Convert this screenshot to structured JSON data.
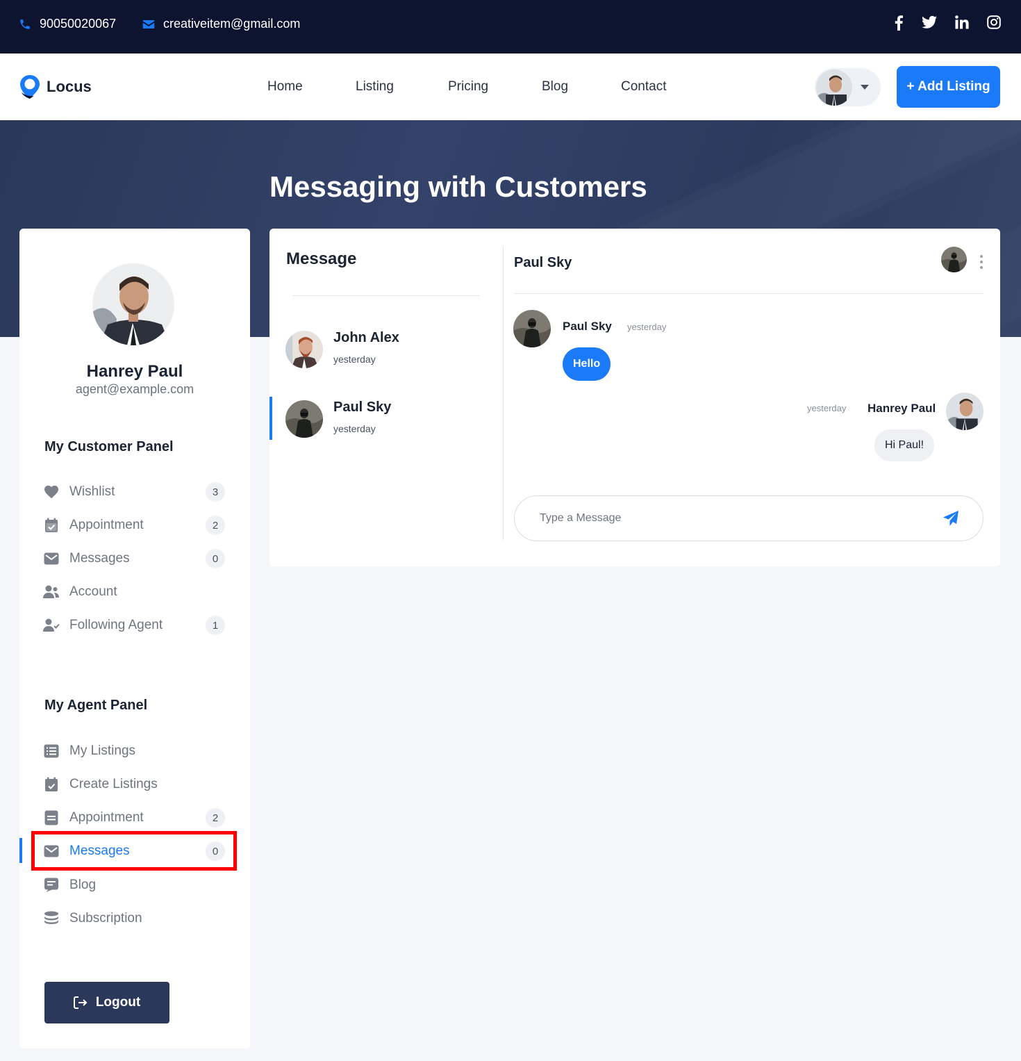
{
  "topbar": {
    "phone": "90050020067",
    "email": "creativeitem@gmail.com",
    "social": [
      "facebook-icon",
      "twitter-icon",
      "linkedin-icon",
      "instagram-icon"
    ]
  },
  "nav": {
    "logo": "Locus",
    "links": [
      "Home",
      "Listing",
      "Pricing",
      "Blog",
      "Contact"
    ],
    "add_listing": "+ Add Listing"
  },
  "hero": {
    "title": "Messaging with Customers"
  },
  "profile": {
    "name": "Hanrey Paul",
    "email": "agent@example.com"
  },
  "customer_panel": {
    "title": "My Customer Panel",
    "items": [
      {
        "label": "Wishlist",
        "icon": "heart-icon",
        "badge": "3"
      },
      {
        "label": "Appointment",
        "icon": "calendar-check-icon",
        "badge": "2"
      },
      {
        "label": "Messages",
        "icon": "envelope-icon",
        "badge": "0"
      },
      {
        "label": "Account",
        "icon": "users-icon",
        "badge": ""
      },
      {
        "label": "Following Agent",
        "icon": "user-check-icon",
        "badge": "1"
      }
    ]
  },
  "agent_panel": {
    "title": "My Agent Panel",
    "items": [
      {
        "label": "My Listings",
        "icon": "list-icon",
        "badge": ""
      },
      {
        "label": "Create Listings",
        "icon": "calendar-check-icon",
        "badge": ""
      },
      {
        "label": "Appointment",
        "icon": "note-icon",
        "badge": "2"
      },
      {
        "label": "Messages",
        "icon": "envelope-icon",
        "badge": "0"
      },
      {
        "label": "Blog",
        "icon": "blog-icon",
        "badge": ""
      },
      {
        "label": "Subscription",
        "icon": "coins-icon",
        "badge": ""
      }
    ]
  },
  "logout": "Logout",
  "messages": {
    "heading": "Message",
    "contacts": [
      {
        "name": "John Alex",
        "time": "yesterday"
      },
      {
        "name": "Paul Sky",
        "time": "yesterday"
      }
    ]
  },
  "chat": {
    "header_name": "Paul Sky",
    "thread": [
      {
        "sender": "Paul Sky",
        "time": "yesterday",
        "text": "Hello"
      },
      {
        "sender": "Hanrey Paul",
        "time": "yesterday",
        "text": "Hi Paul!"
      }
    ],
    "input_placeholder": "Type a Message"
  },
  "colors": {
    "accent": "#1a7af8",
    "topbar": "#0c1430",
    "hero": "#2b3859",
    "logout": "#2b3859"
  }
}
